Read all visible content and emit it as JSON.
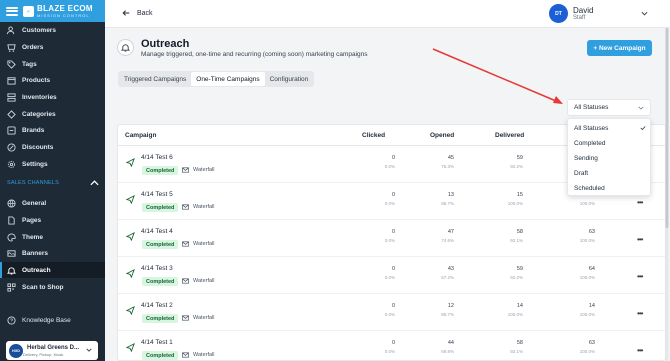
{
  "brand": {
    "line1": "BLAZE ECOM",
    "line2": "MISSION CONTROL"
  },
  "sidebar": {
    "items": [
      {
        "label": "Customers",
        "icon": "users-icon"
      },
      {
        "label": "Orders",
        "icon": "orders-icon"
      },
      {
        "label": "Tags",
        "icon": "tag-icon"
      },
      {
        "label": "Products",
        "icon": "box-icon"
      },
      {
        "label": "Inventories",
        "icon": "inventory-icon"
      },
      {
        "label": "Categories",
        "icon": "categories-icon"
      },
      {
        "label": "Brands",
        "icon": "brands-icon"
      },
      {
        "label": "Discounts",
        "icon": "discount-icon"
      },
      {
        "label": "Settings",
        "icon": "gear-icon"
      }
    ],
    "section_title": "SALES CHANNELS",
    "channel_items": [
      {
        "label": "General",
        "icon": "globe-icon"
      },
      {
        "label": "Pages",
        "icon": "pages-icon"
      },
      {
        "label": "Theme",
        "icon": "theme-icon"
      },
      {
        "label": "Banners",
        "icon": "banner-icon"
      },
      {
        "label": "Outreach",
        "icon": "bell-icon"
      },
      {
        "label": "Scan to Shop",
        "icon": "qr-icon"
      }
    ],
    "knowledge_base": "Knowledge Base",
    "store": {
      "name": "Herbal Greens D...",
      "sub": "Delivery, Pickup, Kiosk",
      "badge": "HGD"
    }
  },
  "topbar": {
    "back": "Back",
    "user_name": "David",
    "user_role": "Staff",
    "avatar": "DT"
  },
  "page": {
    "title": "Outreach",
    "subtitle": "Manage triggered, one-time and recurring (coming soon) marketing campaigns",
    "new_button": "+ New Campaign",
    "tabs": [
      "Triggered Campaigns",
      "One-Time Campaigns",
      "Configuration"
    ]
  },
  "filter": {
    "selected": "All Statuses",
    "options": [
      "All Statuses",
      "Completed",
      "Sending",
      "Draft",
      "Scheduled"
    ]
  },
  "table": {
    "columns": [
      "Campaign",
      "Clicked",
      "Opened",
      "Delivered"
    ],
    "rows": [
      {
        "name": "4/14 Test 6",
        "status": "Completed",
        "type": "Waterfall",
        "clicked": "0",
        "clicked_pct": "0.0%",
        "opened": "45",
        "opened_pct": "76.3%",
        "delivered": "59",
        "delivered_pct": "92.2%",
        "sent": "",
        "sent_pct": ""
      },
      {
        "name": "4/14 Test 5",
        "status": "Completed",
        "type": "Waterfall",
        "clicked": "0",
        "clicked_pct": "0.0%",
        "opened": "13",
        "opened_pct": "86.7%",
        "delivered": "15",
        "delivered_pct": "100.0%",
        "sent": "",
        "sent_pct": "100.0%"
      },
      {
        "name": "4/14 Test 4",
        "status": "Completed",
        "type": "Waterfall",
        "clicked": "0",
        "clicked_pct": "0.0%",
        "opened": "47",
        "opened_pct": "74.6%",
        "delivered": "58",
        "delivered_pct": "92.1%",
        "sent": "63",
        "sent_pct": "100.0%"
      },
      {
        "name": "4/14 Test 3",
        "status": "Completed",
        "type": "Waterfall",
        "clicked": "0",
        "clicked_pct": "0.0%",
        "opened": "43",
        "opened_pct": "67.2%",
        "delivered": "59",
        "delivered_pct": "92.2%",
        "sent": "64",
        "sent_pct": "100.0%"
      },
      {
        "name": "4/14 Test 2",
        "status": "Completed",
        "type": "Waterfall",
        "clicked": "0",
        "clicked_pct": "0.0%",
        "opened": "12",
        "opened_pct": "85.7%",
        "delivered": "14",
        "delivered_pct": "100.0%",
        "sent": "14",
        "sent_pct": "100.0%"
      },
      {
        "name": "4/14 Test 1",
        "status": "Completed",
        "type": "Waterfall",
        "clicked": "0",
        "clicked_pct": "0.0%",
        "opened": "44",
        "opened_pct": "69.8%",
        "delivered": "58",
        "delivered_pct": "92.1%",
        "sent": "63",
        "sent_pct": "100.0%"
      }
    ]
  },
  "colors": {
    "accent": "#2f9fe0",
    "sidebar": "#1e2a36",
    "arrow": "#e53935",
    "status_bg": "#d7f5df"
  }
}
